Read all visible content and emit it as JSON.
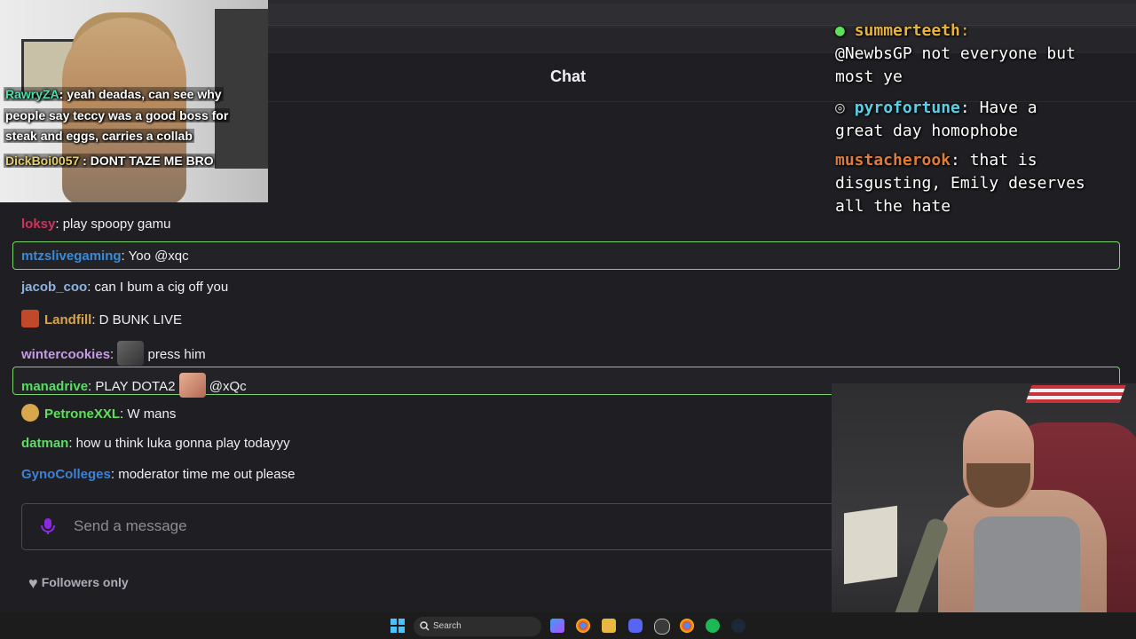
{
  "chat_panel": {
    "title": "Chat",
    "input_placeholder": "Send a message",
    "followers_label": "Followers only"
  },
  "overlay_left": [
    {
      "user": "RawryZA",
      "text": ": yeah deadas, can see why",
      "user_color": "#48e0ad"
    },
    {
      "user": "",
      "text": "people say teccy was a good boss for",
      "user_color": "#ffffff"
    },
    {
      "user": "",
      "text": "steak and eggs, carries a collab",
      "user_color": "#ffffff"
    },
    {
      "user": "DickBoi0057",
      "text": " : DONT TAZE ME BRO",
      "user_color": "#e8d06a"
    }
  ],
  "messages": [
    {
      "user": "loksy",
      "text": ": play spoopy gamu",
      "color": "#d2325c"
    },
    {
      "user": "mtzslivegaming",
      "text": ": Yoo @xqc",
      "color": "#3a8ad6",
      "highlight": true
    },
    {
      "user": "jacob_coo",
      "text": ": can I bum a cig off you",
      "color": "#8db2e0"
    },
    {
      "user": "Landfill",
      "text": ":  D BUNK LIVE",
      "color": "#d8a44f"
    },
    {
      "user": "wintercookies",
      "text": ":",
      "after_emote": " press him",
      "color": "#c69be6"
    },
    {
      "user": "manadrive",
      "text": ": PLAY DOTA2",
      "after_emote": " @xQc",
      "color": "#53e062",
      "highlight": true
    },
    {
      "user": "PetroneXXL",
      "text": ": W mans",
      "color": "#5ee05a"
    },
    {
      "user": "datman",
      "text": ": how u think luka gonna play todayyy",
      "color": "#5cde63"
    },
    {
      "user": "GynoColleges",
      "text": ": moderator time me out please",
      "color": "#3e81d6"
    }
  ],
  "overlay_right": [
    {
      "user": "summerteeth",
      "text": ":",
      "line2": "@NewbsGP not everyone but",
      "line3": "most ye",
      "color": "#e8b33a"
    },
    {
      "user": "pyrofortune",
      "text": ":  Have a",
      "line2": "great day homophobe",
      "color": "#5ad0e6"
    },
    {
      "user": "mustacherook",
      "text": ": that is",
      "line2": "disgusting, Emily deserves",
      "line3": "all the hate",
      "color": "#e07b3a"
    }
  ],
  "taskbar": {
    "search_label": "Search"
  }
}
